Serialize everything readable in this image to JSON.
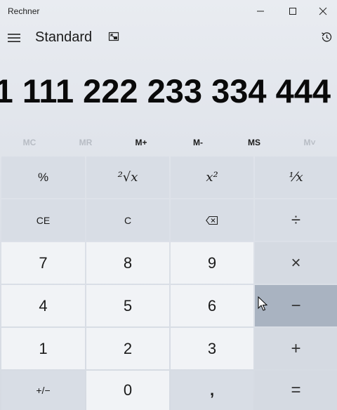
{
  "window": {
    "title": "Rechner",
    "icons": [
      "minimize-icon",
      "maximize-icon",
      "close-icon"
    ]
  },
  "header": {
    "mode": "Standard",
    "icons": [
      "hamburger-menu-icon",
      "keep-on-top-icon",
      "history-icon"
    ]
  },
  "display": {
    "value": "1 111 222 233 334 444"
  },
  "memory": [
    {
      "label": "MC",
      "enabled": false
    },
    {
      "label": "MR",
      "enabled": false
    },
    {
      "label": "M+",
      "enabled": true
    },
    {
      "label": "M-",
      "enabled": true
    },
    {
      "label": "MS",
      "enabled": true
    },
    {
      "label": "M˅",
      "enabled": false
    }
  ],
  "keys": {
    "percent": "%",
    "sqrt": "²√x",
    "square": "x²",
    "reciprocal": "⅟x",
    "ce": "CE",
    "c": "C",
    "backspace_icon": "backspace-icon",
    "divide": "÷",
    "n7": "7",
    "n8": "8",
    "n9": "9",
    "multiply": "×",
    "n4": "4",
    "n5": "5",
    "n6": "6",
    "minus": "−",
    "n1": "1",
    "n2": "2",
    "n3": "3",
    "plus": "+",
    "negate": "+/−",
    "n0": "0",
    "decimal": ",",
    "equals": "="
  },
  "colors": {
    "number_key": "#f1f3f6",
    "function_key": "#d8dde5",
    "hovered_key": "#a9b3c1"
  }
}
